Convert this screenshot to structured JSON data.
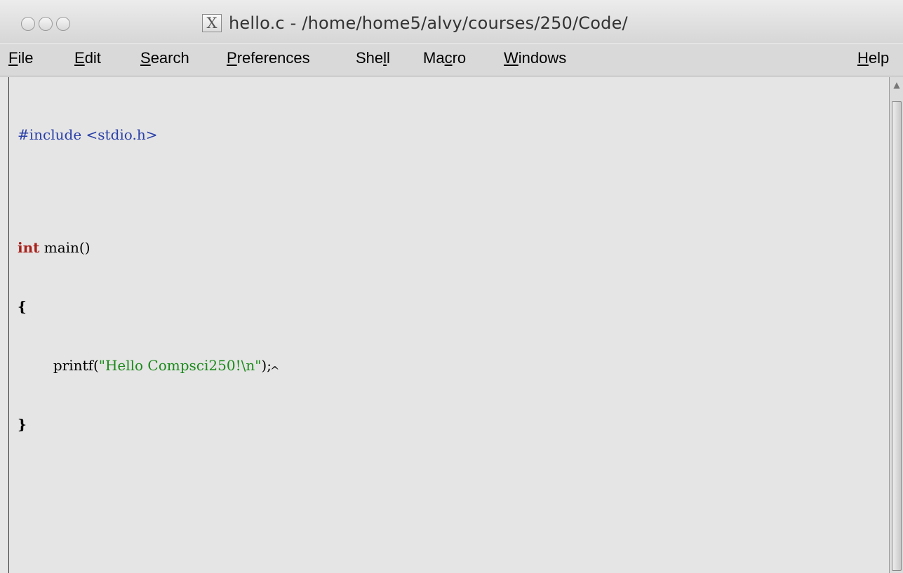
{
  "window": {
    "title": "hello.c - /home/home5/alvy/courses/250/Code/",
    "x_icon_glyph": "X"
  },
  "menu": {
    "items": [
      {
        "label_pre": "",
        "label_u": "F",
        "label_post": "ile"
      },
      {
        "label_pre": "",
        "label_u": "E",
        "label_post": "dit"
      },
      {
        "label_pre": "",
        "label_u": "S",
        "label_post": "earch"
      },
      {
        "label_pre": "",
        "label_u": "P",
        "label_post": "references"
      },
      {
        "label_pre": "She",
        "label_u": "l",
        "label_post": "l"
      },
      {
        "label_pre": "Ma",
        "label_u": "c",
        "label_post": "ro"
      },
      {
        "label_pre": "",
        "label_u": "W",
        "label_post": "indows"
      },
      {
        "label_pre": "",
        "label_u": "H",
        "label_post": "elp"
      }
    ]
  },
  "editor": {
    "line1": "#include <stdio.h>",
    "line2_kw": "int",
    "line2_rest": " main()",
    "line3": "{",
    "line4_indent": "        printf(",
    "line4_str": "\"Hello Compsci250!\\n\"",
    "line4_end": ");",
    "line5": "}",
    "caret_glyph": "^"
  },
  "colors": {
    "preprocessor": "#2a40a8",
    "keyword": "#a8201a",
    "string": "#1a8a1a"
  }
}
